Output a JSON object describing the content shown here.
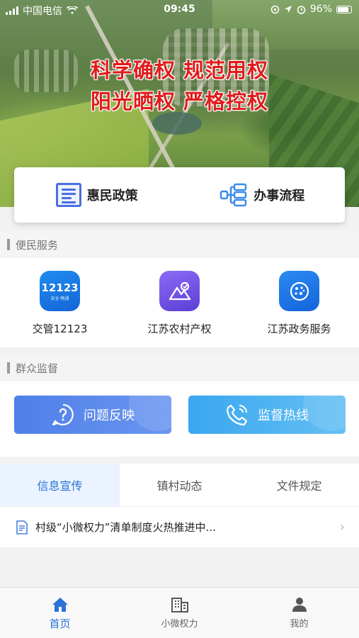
{
  "status_bar": {
    "carrier": "中国电信",
    "time": "09:45",
    "battery": "96%"
  },
  "hero": {
    "slogan_line1": "科学确权 规范用权",
    "slogan_line2": "阳光晒权 严格控权"
  },
  "policy_card": {
    "items": [
      {
        "label": "惠民政策",
        "icon": "document-icon"
      },
      {
        "label": "办事流程",
        "icon": "flow-icon"
      }
    ]
  },
  "sections": {
    "services_title": "便民服务",
    "supervision_title": "群众监督"
  },
  "services": [
    {
      "label": "交管12123",
      "icon": "traffic-12123-icon",
      "icon_text": "12123",
      "icon_subtext": "安全·畅通"
    },
    {
      "label": "江苏农村产权",
      "icon": "rural-property-icon"
    },
    {
      "label": "江苏政务服务",
      "icon": "gov-service-icon"
    }
  ],
  "supervision_buttons": [
    {
      "label": "问题反映",
      "icon": "question-icon",
      "color": "#4f7fe9"
    },
    {
      "label": "监督热线",
      "icon": "phone-icon",
      "color": "#3aa7ef"
    }
  ],
  "tabs": [
    {
      "label": "信息宣传",
      "active": true
    },
    {
      "label": "镇村动态",
      "active": false
    },
    {
      "label": "文件规定",
      "active": false
    }
  ],
  "news": [
    {
      "title": "村级“小微权力”清单制度火热推进中..."
    }
  ],
  "tab_bar": [
    {
      "label": "首页",
      "icon": "home-icon",
      "active": true
    },
    {
      "label": "小微权力",
      "icon": "building-icon",
      "active": false
    },
    {
      "label": "我的",
      "icon": "user-icon",
      "active": false
    }
  ],
  "colors": {
    "accent": "#2a72d8",
    "slogan": "#e11b1b"
  }
}
